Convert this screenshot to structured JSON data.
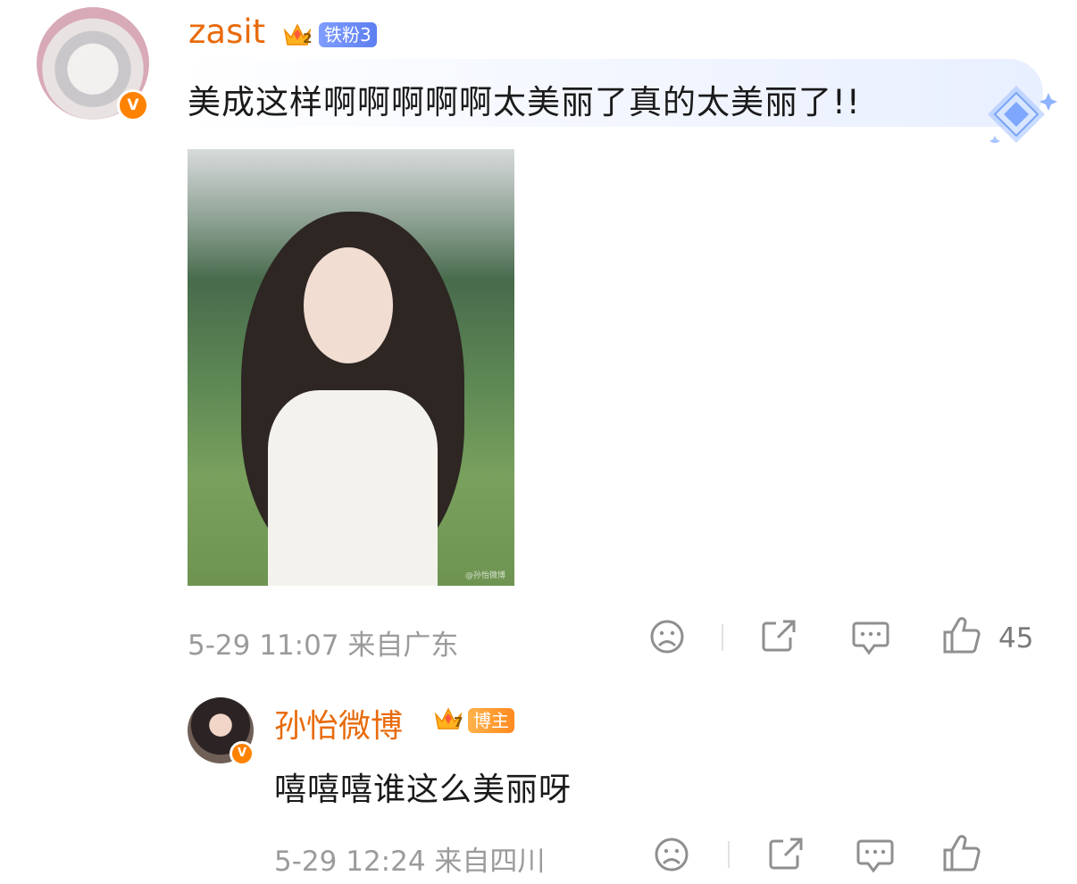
{
  "comments": [
    {
      "username": "zasit",
      "fan_badge": "铁粉3",
      "badge_level": "2",
      "text": "美成这样啊啊啊啊啊太美丽了真的太美丽了!!",
      "date": "5-29",
      "time": "11:07",
      "location": "来自广东",
      "like_count": "45",
      "has_image": true,
      "verified_icon": "v-verified-icon"
    },
    {
      "username": "孙怡微博",
      "fan_badge": "博主",
      "badge_level": "7",
      "text": "嘻嘻嘻谁这么美丽呀",
      "date": "5-29",
      "time": "12:24",
      "location": "来自四川",
      "verified_icon": "v-verified-icon"
    }
  ],
  "icons": {
    "dislike": "sad-face-icon",
    "share": "share-icon",
    "reply": "comment-icon",
    "like": "thumbs-up-icon",
    "decoration": "diamond-sparkle-icon"
  },
  "colors": {
    "username": "#e86b0c",
    "fan_badge_blue": "#6f8ff6",
    "fan_badge_orange": "#ff9a2f",
    "verified": "#ff8200",
    "meta": "#9b9b9b"
  }
}
